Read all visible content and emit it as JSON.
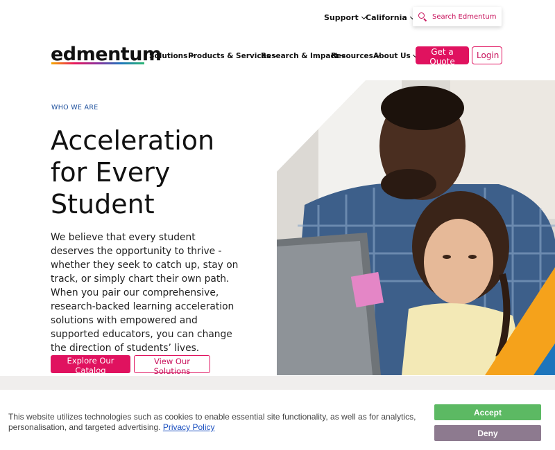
{
  "utility_nav": {
    "support": "Support",
    "region": "California",
    "search_placeholder": "Search Edmentum"
  },
  "brand": {
    "logo_text": "edmentum"
  },
  "main_nav": {
    "items": [
      "Solutions",
      "Products & Services",
      "Research & Impact",
      "Resources",
      "About Us"
    ],
    "quote_button": "Get a Quote",
    "login_button": "Login"
  },
  "hero": {
    "eyebrow": "WHO WE ARE",
    "title": "Acceleration for Every Student",
    "body": "We believe that every student deserves the opportunity to thrive - whether they seek to catch up, stay on track, or simply chart their own path. When you pair our comprehensive, research-backed learning acceleration solutions with empowered and supported educators, you can change the direction of students’ lives.",
    "primary_button": "Explore Our Catalog",
    "secondary_button": "View Our Solutions"
  },
  "cookie_banner": {
    "text": "This website utilizes technologies such as cookies to enable essential site functionality, as well as for analytics, personalisation, and targeted advertising.",
    "policy_link": "Privacy Policy",
    "accept": "Accept",
    "deny": "Deny"
  },
  "colors": {
    "brand_pink": "#e0125f",
    "accept_green": "#5cb963",
    "deny_mauve": "#8d7a8f",
    "eyebrow_blue": "#1d4f9c"
  }
}
